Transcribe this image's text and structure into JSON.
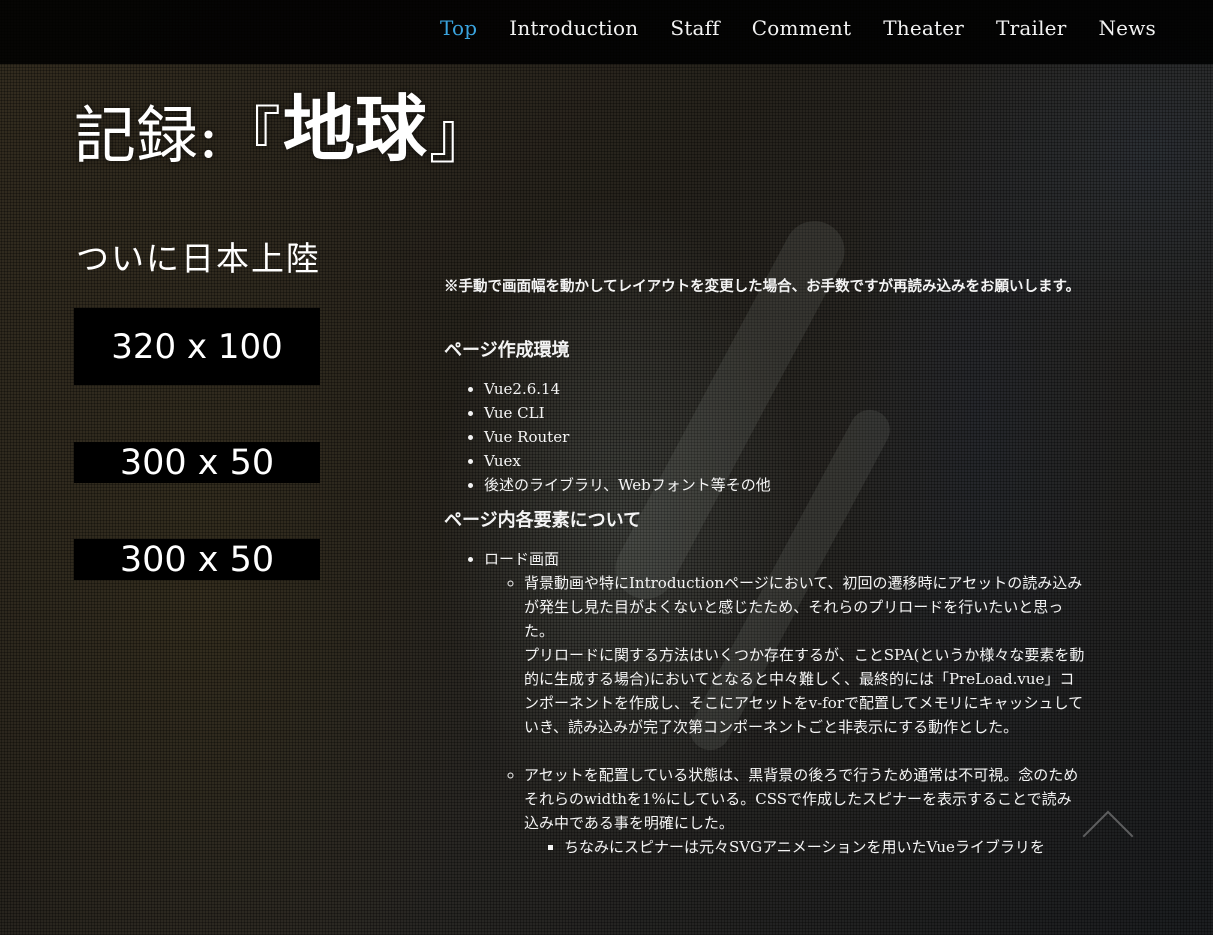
{
  "nav": {
    "items": [
      {
        "label": "Top",
        "active": true
      },
      {
        "label": "Introduction",
        "active": false
      },
      {
        "label": "Staff",
        "active": false
      },
      {
        "label": "Comment",
        "active": false
      },
      {
        "label": "Theater",
        "active": false
      },
      {
        "label": "Trailer",
        "active": false
      },
      {
        "label": "News",
        "active": false
      }
    ],
    "active_color": "#3aa3de"
  },
  "logo": {
    "prefix": "記録:",
    "open_bracket": "『",
    "main": "地球",
    "close_bracket": "』"
  },
  "tagline": "ついに日本上陸",
  "ads": [
    "320 x 100",
    "300 x 50",
    "300 x 50"
  ],
  "content": {
    "notice": "※手動で画面幅を動かしてレイアウトを変更した場合、お手数ですが再読み込みをお願いします。",
    "section1": {
      "heading": "ページ作成環境",
      "items": [
        "Vue2.6.14",
        "Vue CLI",
        "Vue Router",
        "Vuex",
        "後述のライブラリ、Webフォント等その他"
      ]
    },
    "section2": {
      "heading": "ページ内各要素について",
      "item1": "ロード画面",
      "sub1_p1": "背景動画や特にIntroductionページにおいて、初回の遷移時にアセットの読み込みが発生し見た目がよくないと感じたため、それらのプリロードを行いたいと思った。",
      "sub1_p2": "プリロードに関する方法はいくつか存在するが、ことSPA(というか様々な要素を動的に生成する場合)においてとなると中々難しく、最終的には「PreLoad.vue」コンポーネントを作成し、そこにアセットをv-forで配置してメモリにキャッシュしていき、読み込みが完了次第コンポーネントごと非表示にする動作とした。",
      "sub2": "アセットを配置している状態は、黒背景の後ろで行うため通常は不可視。念のためそれらのwidthを1%にしている。CSSで作成したスピナーを表示することで読み込み中である事を明確にした。",
      "sub2_item": "ちなみにスピナーは元々SVGアニメーションを用いたVueライブラリを"
    }
  }
}
